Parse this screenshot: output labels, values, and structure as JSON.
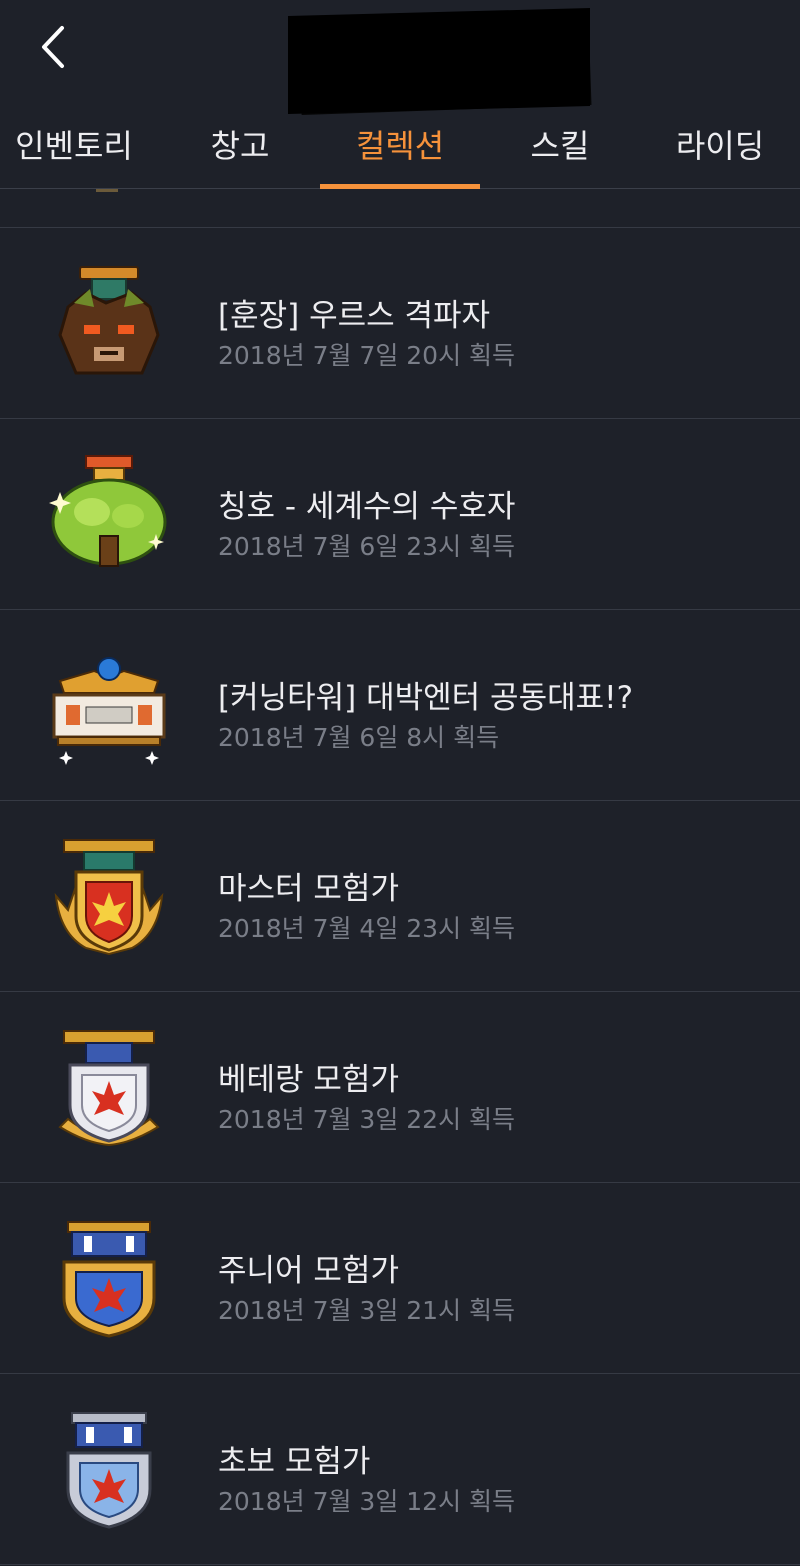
{
  "tabs": [
    {
      "label": "인벤토리"
    },
    {
      "label": "창고"
    },
    {
      "label": "컬렉션"
    },
    {
      "label": "스킬"
    },
    {
      "label": "라이딩"
    }
  ],
  "active_tab": "컬렉션",
  "colors": {
    "accent": "#f6923b",
    "background": "#1e2129",
    "muted": "#7a7e88"
  },
  "items": [
    {
      "title": "[훈장] 우르스 격파자",
      "date": "2018년 7월 7일 20시 획득",
      "icon": "ursus-medal-icon"
    },
    {
      "title": "칭호 - 세계수의 수호자",
      "date": "2018년 7월 6일 23시 획득",
      "icon": "world-tree-medal-icon"
    },
    {
      "title": "[커닝타워] 대박엔터 공동대표!?",
      "date": "2018년 7월 6일 8시 획득",
      "icon": "kerning-tower-medal-icon"
    },
    {
      "title": "마스터 모험가",
      "date": "2018년 7월 4일 23시 획득",
      "icon": "master-adventurer-medal-icon"
    },
    {
      "title": "베테랑 모험가",
      "date": "2018년 7월 3일 22시 획득",
      "icon": "veteran-adventurer-medal-icon"
    },
    {
      "title": "주니어 모험가",
      "date": "2018년 7월 3일 21시 획득",
      "icon": "junior-adventurer-medal-icon"
    },
    {
      "title": "초보 모험가",
      "date": "2018년 7월 3일 12시 획득",
      "icon": "beginner-adventurer-medal-icon"
    }
  ]
}
